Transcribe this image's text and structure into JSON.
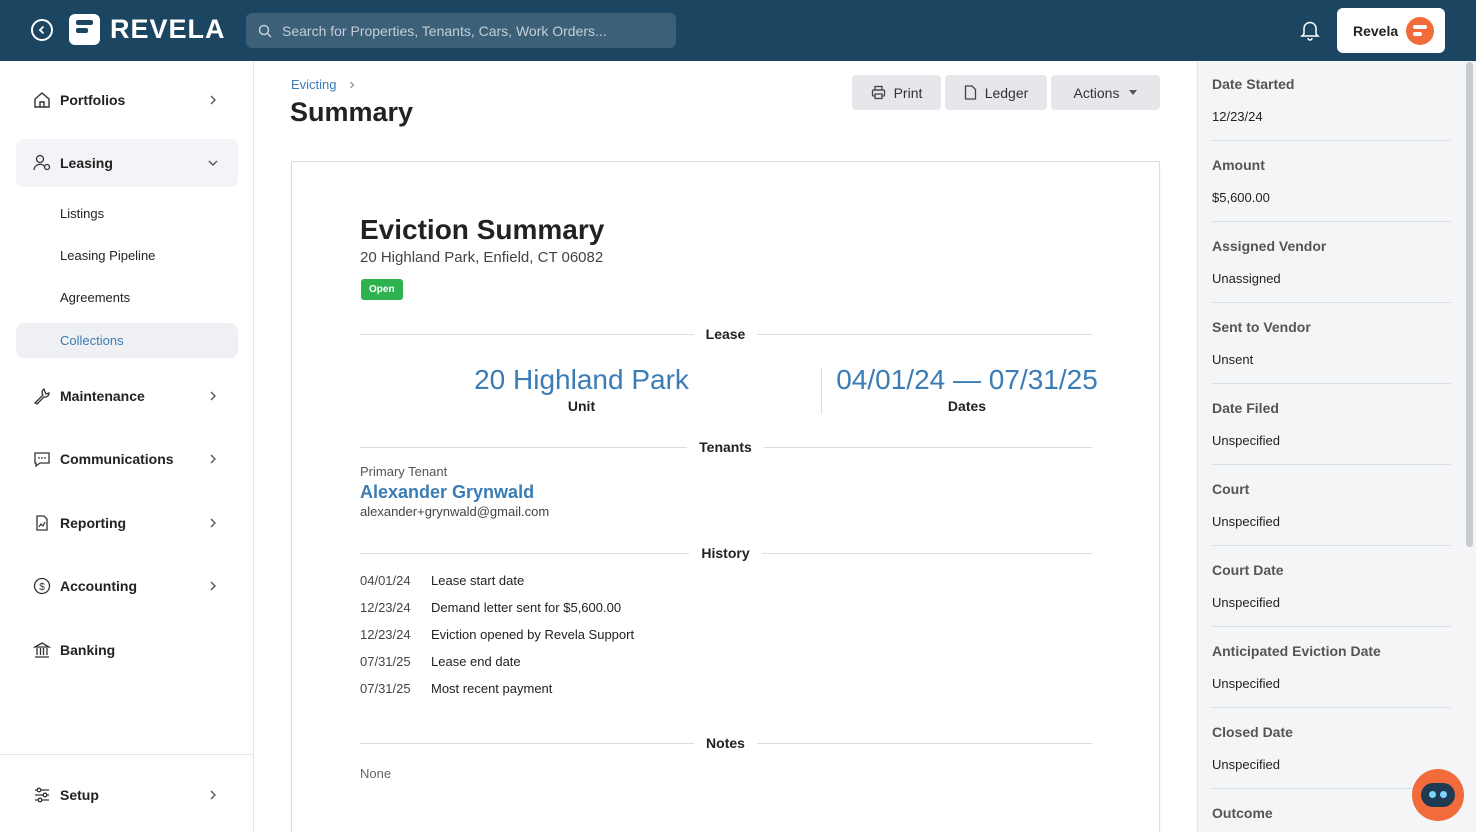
{
  "header": {
    "logo_text": "REVELA",
    "search_placeholder": "Search for Properties, Tenants, Cars, Work Orders...",
    "user_label": "Revela"
  },
  "sidebar": {
    "items": [
      {
        "label": "Portfolios",
        "icon": "home-icon"
      },
      {
        "label": "Leasing",
        "icon": "users-icon",
        "expanded": true
      },
      {
        "label": "Maintenance",
        "icon": "wrench-icon"
      },
      {
        "label": "Communications",
        "icon": "chat-icon"
      },
      {
        "label": "Reporting",
        "icon": "report-icon"
      },
      {
        "label": "Accounting",
        "icon": "dollar-icon"
      },
      {
        "label": "Banking",
        "icon": "bank-icon"
      }
    ],
    "leasing_sub": [
      {
        "label": "Listings"
      },
      {
        "label": "Leasing Pipeline"
      },
      {
        "label": "Agreements"
      },
      {
        "label": "Collections",
        "active": true
      }
    ],
    "setup_label": "Setup"
  },
  "main": {
    "breadcrumb": "Evicting",
    "title": "Summary",
    "buttons": {
      "print": "Print",
      "ledger": "Ledger",
      "actions": "Actions"
    },
    "summary": {
      "title": "Eviction Summary",
      "address": "20 Highland Park, Enfield, CT 06082",
      "status": "Open",
      "sections": {
        "lease": "Lease",
        "tenants": "Tenants",
        "history": "History",
        "notes": "Notes"
      },
      "lease": {
        "unit_value": "20 Highland Park",
        "unit_label": "Unit",
        "dates_value": "04/01/24 — 07/31/25",
        "dates_label": "Dates"
      },
      "tenant": {
        "role": "Primary Tenant",
        "name": "Alexander Grynwald",
        "email": "alexander+grynwald@gmail.com"
      },
      "history": [
        {
          "date": "04/01/24",
          "event": "Lease start date"
        },
        {
          "date": "12/23/24",
          "event": "Demand letter sent for $5,600.00"
        },
        {
          "date": "12/23/24",
          "event": "Eviction opened by Revela Support"
        },
        {
          "date": "07/31/25",
          "event": "Lease end date"
        },
        {
          "date": "07/31/25",
          "event": "Most recent payment"
        }
      ],
      "notes": "None"
    }
  },
  "details": [
    {
      "label": "Date Started",
      "value": "12/23/24"
    },
    {
      "label": "Amount",
      "value": "$5,600.00"
    },
    {
      "label": "Assigned Vendor",
      "value": "Unassigned"
    },
    {
      "label": "Sent to Vendor",
      "value": "Unsent"
    },
    {
      "label": "Date Filed",
      "value": "Unspecified"
    },
    {
      "label": "Court",
      "value": "Unspecified"
    },
    {
      "label": "Court Date",
      "value": "Unspecified"
    },
    {
      "label": "Anticipated Eviction Date",
      "value": "Unspecified"
    },
    {
      "label": "Closed Date",
      "value": "Unspecified"
    },
    {
      "label": "Outcome",
      "value": ""
    }
  ],
  "colors": {
    "header_bg": "#1b4560",
    "accent": "#3a7cb5",
    "status_open": "#2db24f",
    "brand_orange": "#f26b3a"
  }
}
